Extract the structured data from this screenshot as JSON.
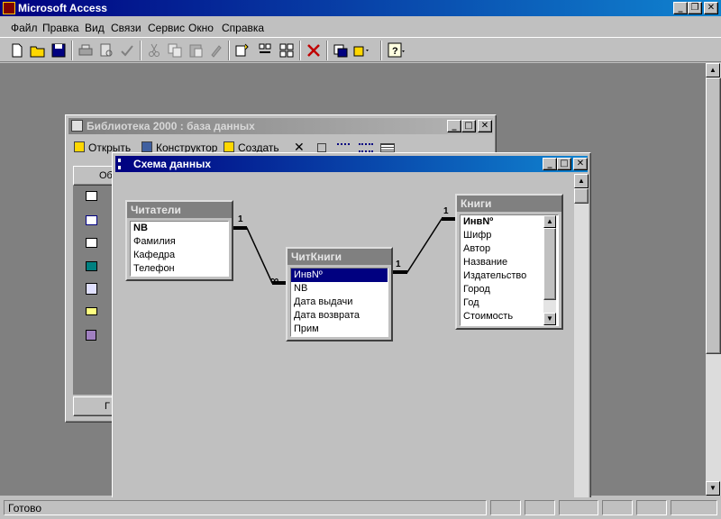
{
  "app": {
    "title": "Microsoft Access",
    "menu": [
      "Файл",
      "Правка",
      "Вид",
      "Связи",
      "Сервис",
      "Окно",
      "Справка"
    ]
  },
  "toolbar": {
    "icons": [
      "new-icon",
      "open-icon",
      "save-icon",
      "print-icon",
      "print-preview-icon",
      "spelling-icon",
      "cut-icon",
      "copy-icon",
      "paste-icon",
      "format-painter-icon",
      "show-table-icon",
      "show-direct-icon",
      "show-all-icon",
      "delete-icon",
      "new-object-icon",
      "new-object-dropdown-icon",
      "help-icon"
    ]
  },
  "db_window": {
    "title": "Библиотека 2000 : база данных",
    "btn_open": "Открыть",
    "btn_design": "Конструктор",
    "btn_create": "Создать",
    "tab_partial": "Об",
    "groups_partial": "Г"
  },
  "schema_window": {
    "title": "Схема данных",
    "tables": [
      {
        "name": "Читатели",
        "fields": [
          "NB",
          "Фамилия",
          "Кафедра",
          "Телефон"
        ],
        "key_field": "NB"
      },
      {
        "name": "ЧитКниги",
        "fields": [
          "ИнвNº",
          "NB",
          "Дата выдачи",
          "Дата возврата",
          "Прим"
        ],
        "selected_field": "ИнвNº"
      },
      {
        "name": "Книги",
        "fields": [
          "ИнвNº",
          "Шифр",
          "Автор",
          "Название",
          "Издательство",
          "Город",
          "Год",
          "Стоимость"
        ],
        "key_field": "ИнвNº"
      }
    ],
    "relations": [
      {
        "one_label": "1",
        "many_label": "∞"
      },
      {
        "one_label": "1",
        "many_label": "1"
      }
    ]
  },
  "status": {
    "text": "Готово"
  }
}
